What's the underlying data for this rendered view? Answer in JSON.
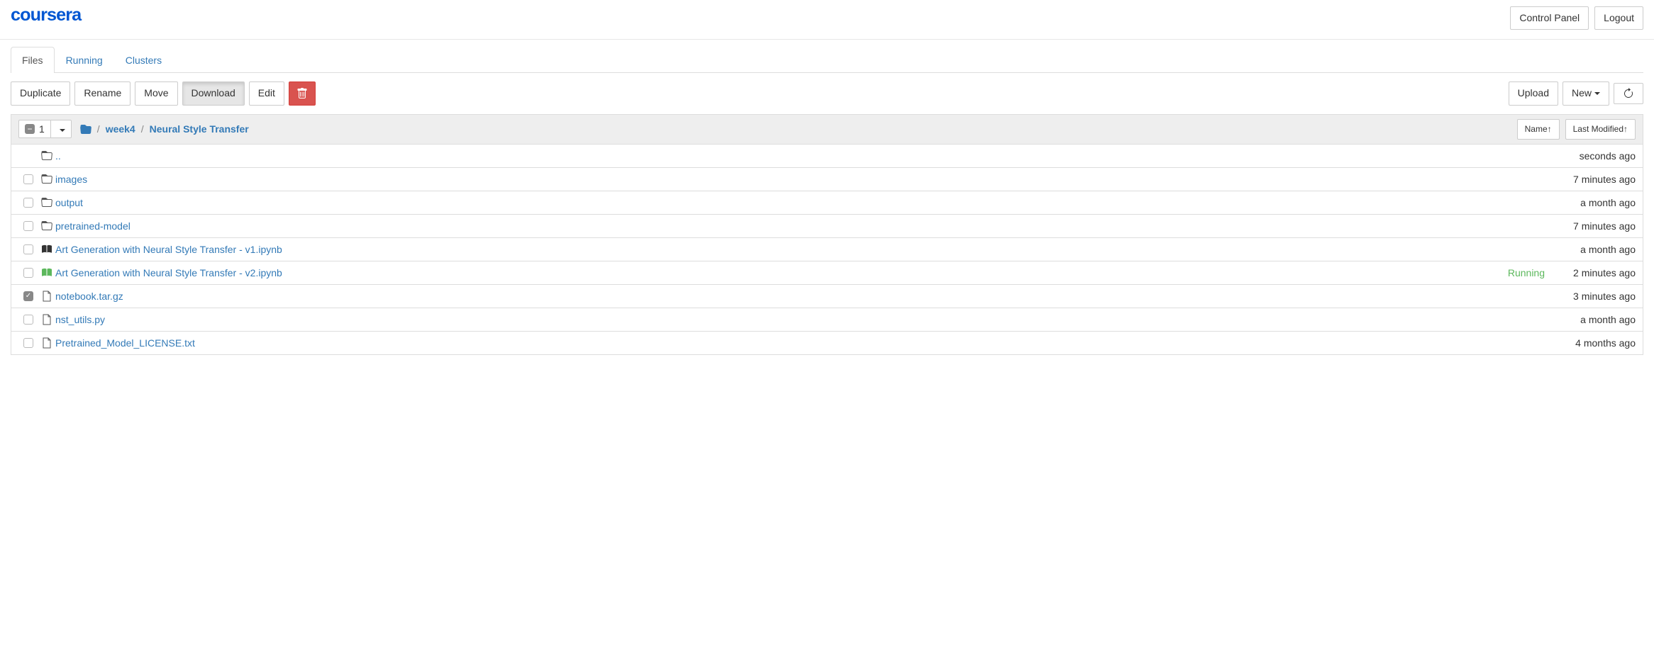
{
  "header": {
    "logo_text": "coursera",
    "control_panel": "Control Panel",
    "logout": "Logout"
  },
  "tabs": {
    "files": "Files",
    "running": "Running",
    "clusters": "Clusters"
  },
  "toolbar": {
    "duplicate": "Duplicate",
    "rename": "Rename",
    "move": "Move",
    "download": "Download",
    "edit": "Edit",
    "upload": "Upload",
    "new": "New"
  },
  "selection": {
    "count": "1"
  },
  "breadcrumb": {
    "items": [
      "week4",
      "Neural Style Transfer"
    ]
  },
  "sort": {
    "name": "Name",
    "last_modified": "Last Modified"
  },
  "files": [
    {
      "type": "parent",
      "name": "..",
      "modified": "seconds ago",
      "checked": false,
      "status": ""
    },
    {
      "type": "folder",
      "name": "images",
      "modified": "7 minutes ago",
      "checked": false,
      "status": ""
    },
    {
      "type": "folder",
      "name": "output",
      "modified": "a month ago",
      "checked": false,
      "status": ""
    },
    {
      "type": "folder",
      "name": "pretrained-model",
      "modified": "7 minutes ago",
      "checked": false,
      "status": ""
    },
    {
      "type": "notebook",
      "name": "Art Generation with Neural Style Transfer - v1.ipynb",
      "modified": "a month ago",
      "checked": false,
      "status": ""
    },
    {
      "type": "notebook-running",
      "name": "Art Generation with Neural Style Transfer - v2.ipynb",
      "modified": "2 minutes ago",
      "checked": false,
      "status": "Running"
    },
    {
      "type": "file",
      "name": "notebook.tar.gz",
      "modified": "3 minutes ago",
      "checked": true,
      "status": ""
    },
    {
      "type": "file",
      "name": "nst_utils.py",
      "modified": "a month ago",
      "checked": false,
      "status": ""
    },
    {
      "type": "file",
      "name": "Pretrained_Model_LICENSE.txt",
      "modified": "4 months ago",
      "checked": false,
      "status": ""
    }
  ]
}
